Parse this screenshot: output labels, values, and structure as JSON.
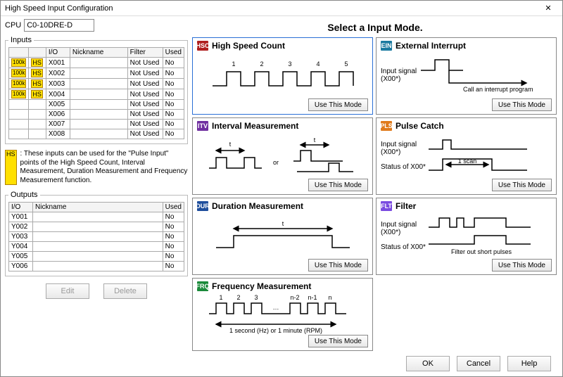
{
  "window": {
    "title": "High Speed Input Configuration",
    "close": "✕"
  },
  "cpu": {
    "label": "CPU",
    "value": "C0-10DRE-D"
  },
  "inputs": {
    "legend": "Inputs",
    "cols": {
      "rate": "",
      "hs": "",
      "io": "I/O",
      "nick": "Nickname",
      "filter": "Filter",
      "used": "Used"
    },
    "rows": [
      {
        "rate": "100k",
        "hs": "HS",
        "io": "X001",
        "nick": "",
        "filter": "Not Used",
        "used": "No"
      },
      {
        "rate": "100k",
        "hs": "HS",
        "io": "X002",
        "nick": "",
        "filter": "Not Used",
        "used": "No"
      },
      {
        "rate": "100k",
        "hs": "HS",
        "io": "X003",
        "nick": "",
        "filter": "Not Used",
        "used": "No"
      },
      {
        "rate": "100k",
        "hs": "HS",
        "io": "X004",
        "nick": "",
        "filter": "Not Used",
        "used": "No"
      },
      {
        "rate": "",
        "hs": "",
        "io": "X005",
        "nick": "",
        "filter": "Not Used",
        "used": "No"
      },
      {
        "rate": "",
        "hs": "",
        "io": "X006",
        "nick": "",
        "filter": "Not Used",
        "used": "No"
      },
      {
        "rate": "",
        "hs": "",
        "io": "X007",
        "nick": "",
        "filter": "Not Used",
        "used": "No"
      },
      {
        "rate": "",
        "hs": "",
        "io": "X008",
        "nick": "",
        "filter": "Not Used",
        "used": "No"
      }
    ]
  },
  "hs_note": {
    "badge": "HS",
    "text": ": These inputs can be used for the \"Pulse Input\" points of the High Speed Count, Interval Measurement, Duration Measurement and Frequency Measurement function."
  },
  "outputs": {
    "legend": "Outputs",
    "cols": {
      "io": "I/O",
      "nick": "Nickname",
      "used": "Used"
    },
    "rows": [
      {
        "io": "Y001",
        "nick": "",
        "used": "No"
      },
      {
        "io": "Y002",
        "nick": "",
        "used": "No"
      },
      {
        "io": "Y003",
        "nick": "",
        "used": "No"
      },
      {
        "io": "Y004",
        "nick": "",
        "used": "No"
      },
      {
        "io": "Y005",
        "nick": "",
        "used": "No"
      },
      {
        "io": "Y006",
        "nick": "",
        "used": "No"
      }
    ]
  },
  "left_buttons": {
    "edit": "Edit",
    "delete": "Delete"
  },
  "right_title": "Select a Input Mode.",
  "modes": {
    "hsc": {
      "icon": "HSC",
      "title": "High Speed Count",
      "use": "Use This Mode",
      "nums": [
        "1",
        "2",
        "3",
        "4",
        "5"
      ]
    },
    "ein": {
      "icon": "EIN",
      "title": "External Interrupt",
      "use": "Use This Mode",
      "l1": "Input signal",
      "l2": "(X00*)",
      "note": "Call an interrupt program"
    },
    "itv": {
      "icon": "ITV",
      "title": "Interval Measurement",
      "use": "Use This Mode",
      "t": "t",
      "or": "or"
    },
    "pls": {
      "icon": "PLS",
      "title": "Pulse Catch",
      "use": "Use This Mode",
      "l1": "Input signal",
      "l2": "(X00*)",
      "l3": "Status of X00*",
      "scan": "1 scan"
    },
    "dur": {
      "icon": "DUR",
      "title": "Duration Measurement",
      "use": "Use This Mode",
      "t": "t"
    },
    "flt": {
      "icon": "FLT",
      "title": "Filter",
      "use": "Use This Mode",
      "l1": "Input signal",
      "l2": "(X00*)",
      "l3": "Status of X00*",
      "note": "Filter out short pulses"
    },
    "frq": {
      "icon": "FRQ",
      "title": "Frequency Measurement",
      "use": "Use This Mode",
      "nums": [
        "1",
        "2",
        "3",
        "n-2",
        "n-1",
        "n"
      ],
      "caption": "1 second (Hz) or 1 minute (RPM)"
    }
  },
  "footer": {
    "ok": "OK",
    "cancel": "Cancel",
    "help": "Help"
  }
}
